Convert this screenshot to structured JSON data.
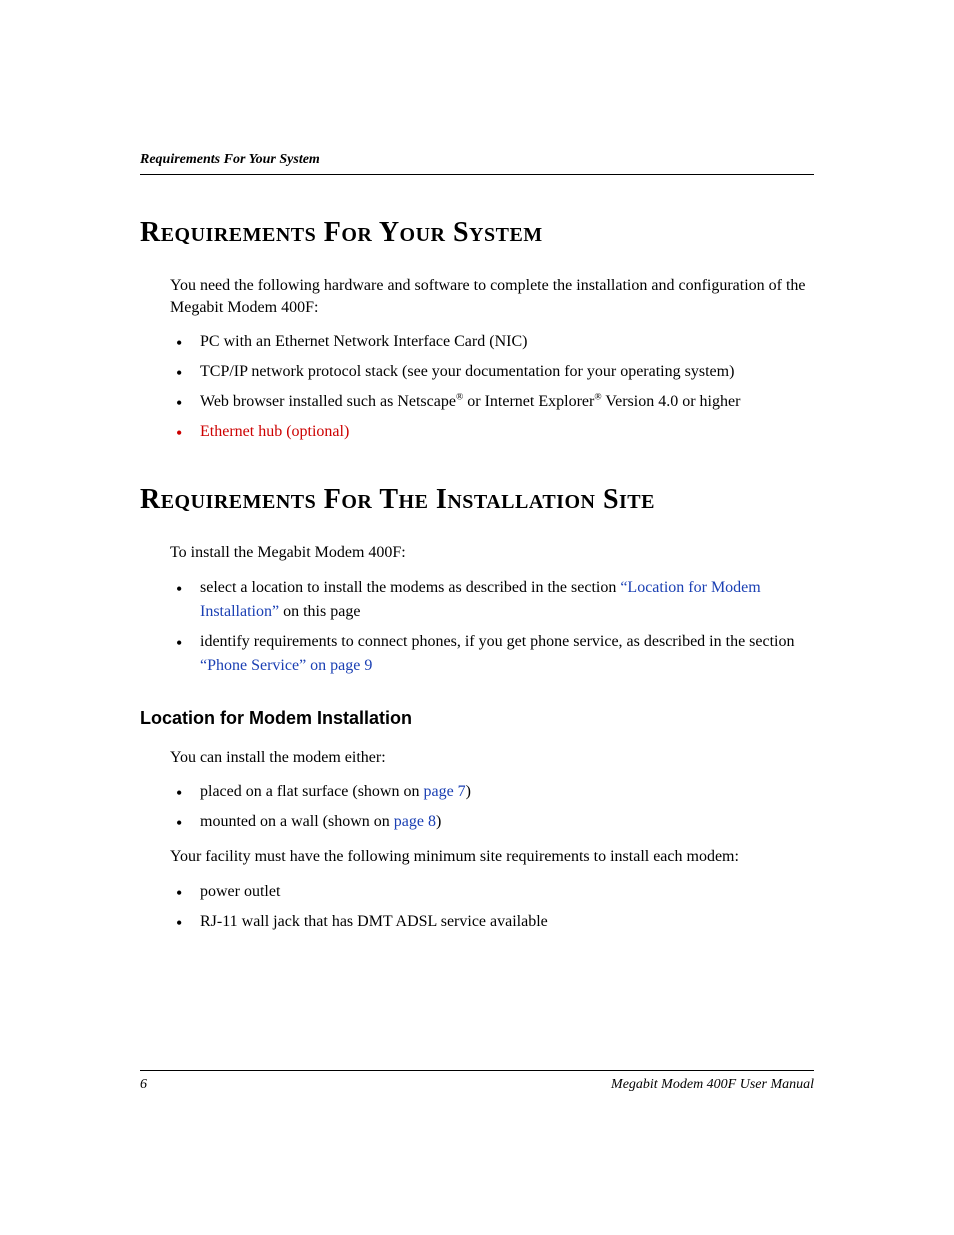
{
  "header": {
    "running_title": "Requirements For Your System"
  },
  "section1": {
    "title": "Requirements For Your System",
    "intro": "You need the following hardware and software to complete the installation and configuration of the Megabit Modem 400F:",
    "items": {
      "i0": "PC with an Ethernet Network Interface Card (NIC)",
      "i1": "TCP/IP network protocol stack (see your documentation for your operating system)",
      "i2_a": "Web browser installed such as Netscape",
      "i2_b": " or Internet Explorer",
      "i2_c": " Version 4.0 or higher",
      "reg": "®",
      "i3": "Ethernet hub (optional)"
    }
  },
  "section2": {
    "title": "Requirements For The Installation Site",
    "intro": "To install the Megabit Modem 400F:",
    "items": {
      "i0_a": "select a location to install the modems as described in the section ",
      "i0_link": "“Location for Modem Installation”",
      "i0_b": " on this page",
      "i1_a": "identify requirements to connect phones, if you get phone service, as described in the section ",
      "i1_link": "“Phone Service” on page 9"
    }
  },
  "subsection": {
    "title": "Location for Modem Installation",
    "p1": "You can install the modem either:",
    "items1": {
      "i0_a": "placed on a flat surface (shown on ",
      "i0_link": "page 7",
      "i0_b": ")",
      "i1_a": "mounted on a wall (shown on ",
      "i1_link": "page 8",
      "i1_b": ")"
    },
    "p2": "Your facility must have the following minimum site requirements to install each modem:",
    "items2": {
      "i0": "power outlet",
      "i1": "RJ-11 wall jack that has DMT ADSL service available"
    }
  },
  "footer": {
    "page": "6",
    "manual": "Megabit Modem 400F User Manual"
  }
}
